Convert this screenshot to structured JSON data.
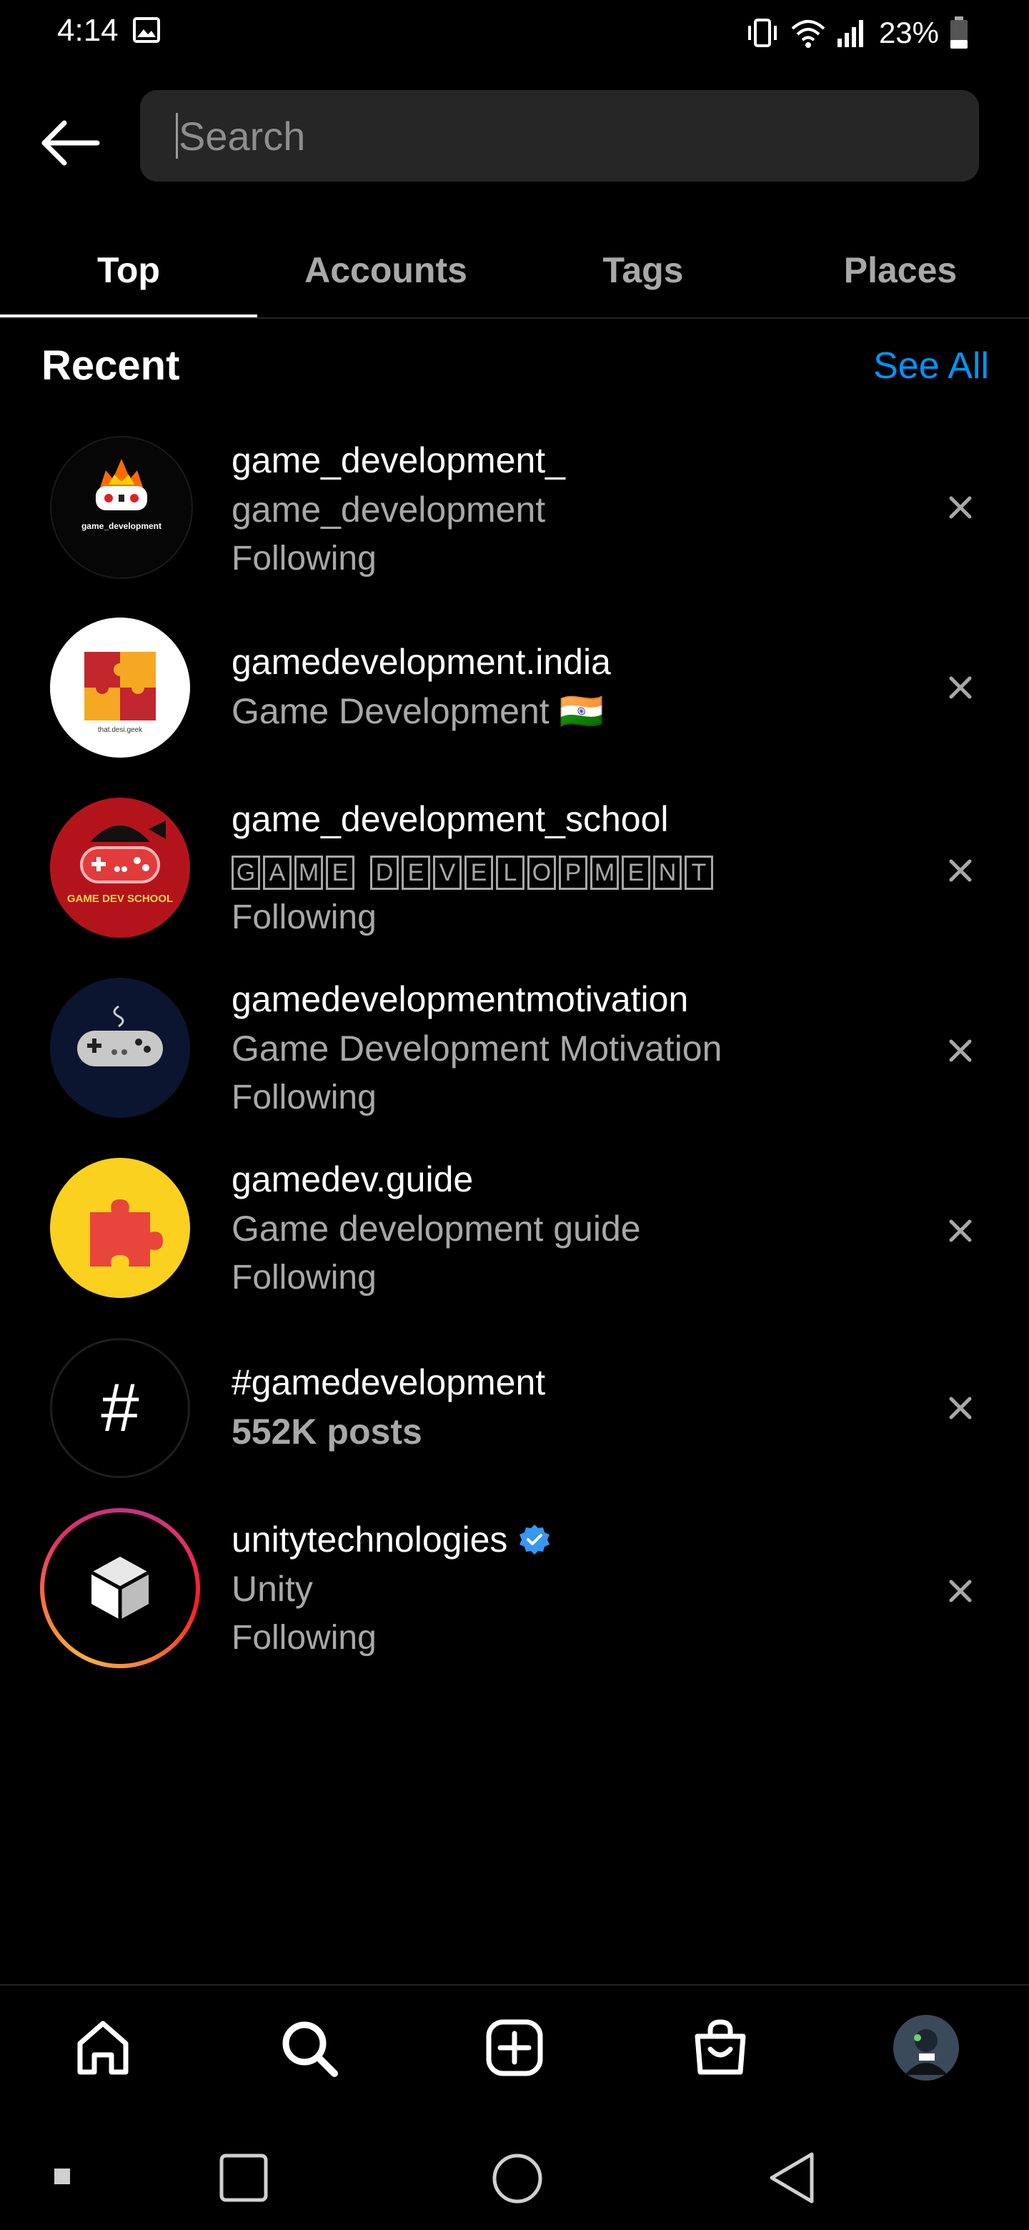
{
  "status_bar": {
    "time": "4:14",
    "battery": "23%"
  },
  "search": {
    "placeholder": "Search",
    "value": ""
  },
  "tabs": [
    {
      "label": "Top",
      "active": true
    },
    {
      "label": "Accounts",
      "active": false
    },
    {
      "label": "Tags",
      "active": false
    },
    {
      "label": "Places",
      "active": false
    }
  ],
  "recent": {
    "title": "Recent",
    "see_all": "See All",
    "items": [
      {
        "username": "game_development_",
        "name": "game_development",
        "status": "Following",
        "avatar_label": "game_development"
      },
      {
        "username": "gamedevelopment.india",
        "name": "Game Development 🇮🇳",
        "status": "",
        "avatar_label": "that.desi.geek"
      },
      {
        "username": "game_development_school",
        "name": "GAME DEVELOPMENT",
        "status": "Following",
        "avatar_label": "GAME DEV SCHOOL"
      },
      {
        "username": "gamedevelopmentmotivation",
        "name": "Game Development Motivation",
        "status": "Following"
      },
      {
        "username": "gamedev.guide",
        "name": "Game development guide",
        "status": "Following"
      },
      {
        "username": "#gamedevelopment",
        "name": "552K posts",
        "status": "",
        "hashtag_symbol": "#"
      },
      {
        "username": "unitytechnologies",
        "name": "Unity",
        "status": "Following",
        "verified": true
      }
    ]
  },
  "colors": {
    "background": "#000000",
    "accent_link": "#0095f6",
    "search_field": "#262626",
    "secondary_text": "#a8a8a8",
    "verified_badge": "#3897f0"
  },
  "icons": {
    "back": "arrow-left-icon",
    "remove": "close-icon",
    "nav": [
      "home-icon",
      "search-icon",
      "create-icon",
      "shop-icon",
      "profile-avatar"
    ],
    "system_nav": [
      "recents-icon",
      "home-circle-icon",
      "back-triangle-icon"
    ]
  }
}
